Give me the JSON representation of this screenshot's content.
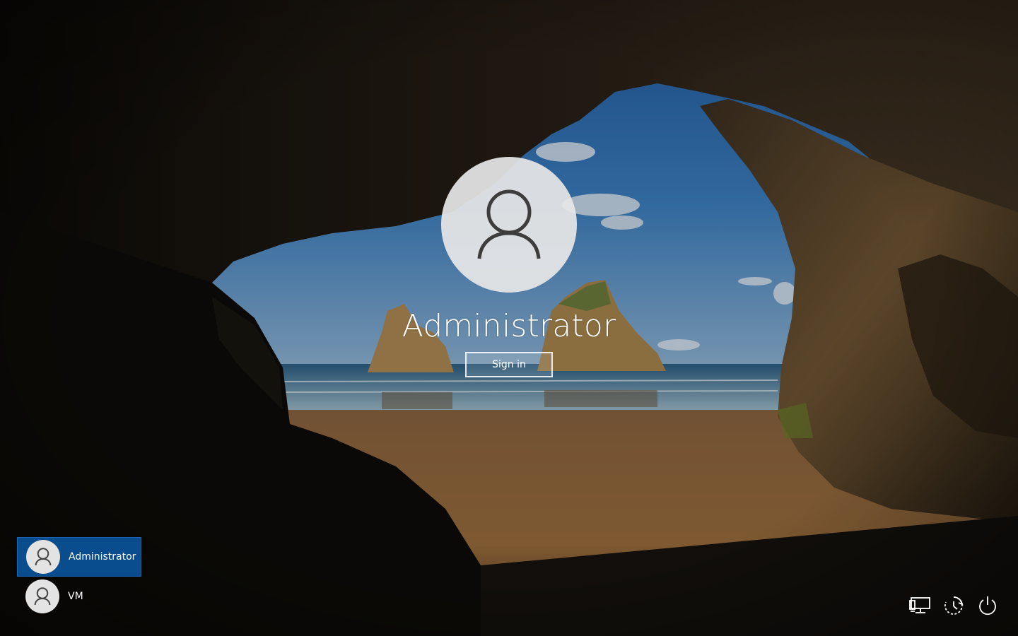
{
  "lock_screen": {
    "selected_user": "Administrator",
    "sign_in_label": "Sign in",
    "avatar_icon": "user-silhouette-icon"
  },
  "user_list": [
    {
      "name": "Administrator",
      "selected": true,
      "icon": "user-silhouette-icon"
    },
    {
      "name": "VM",
      "selected": false,
      "icon": "user-silhouette-icon"
    }
  ],
  "tray": {
    "icons": [
      "network-icon",
      "ease-of-access-icon",
      "power-icon"
    ]
  },
  "colors": {
    "selected_user_bg": "#0a4d8f",
    "avatar_bg": "#e6e6e6",
    "sky": "#2f6fb0",
    "sand": "#9a6a3a"
  }
}
